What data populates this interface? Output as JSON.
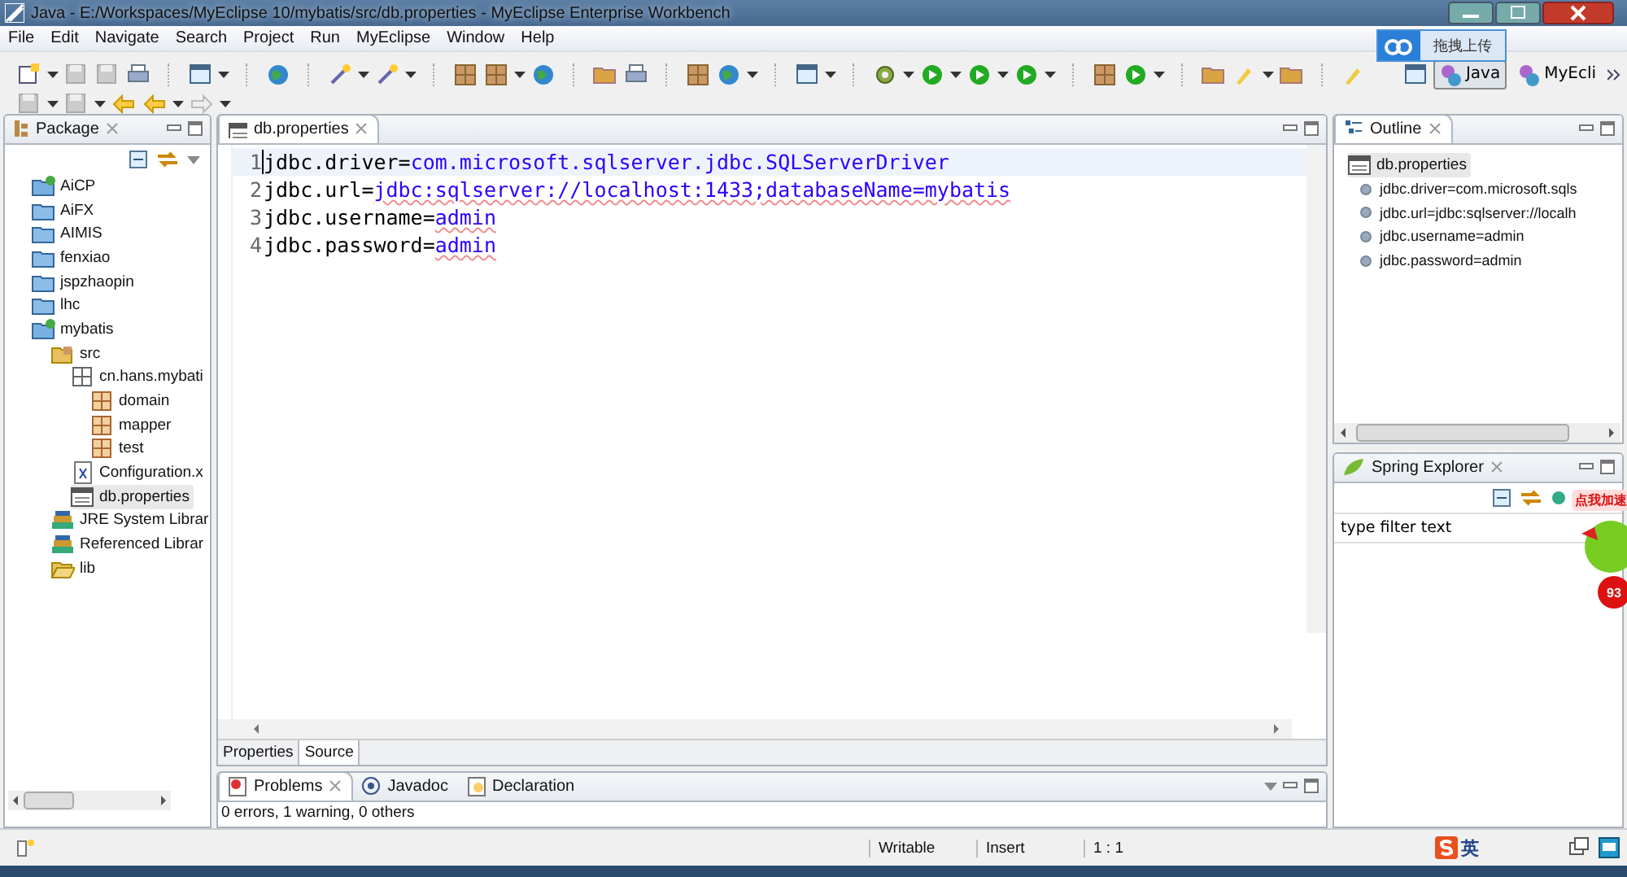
{
  "window": {
    "title": "Java - E:/Workspaces/MyEclipse 10/mybatis/src/db.properties - MyEclipse Enterprise Workbench"
  },
  "menu": [
    "File",
    "Edit",
    "Navigate",
    "Search",
    "Project",
    "Run",
    "MyEclipse",
    "Window",
    "Help"
  ],
  "upload_popup": {
    "label": "拖拽上传"
  },
  "perspectives": [
    {
      "label": "Java",
      "selected": true
    },
    {
      "label": "MyEcli",
      "selected": false
    }
  ],
  "package_view": {
    "title": "Package",
    "items": [
      {
        "label": "AiCP",
        "kind": "project",
        "selected": false
      },
      {
        "label": "AiFX",
        "kind": "folder",
        "selected": false
      },
      {
        "label": "AIMIS",
        "kind": "folder",
        "selected": false
      },
      {
        "label": "fenxiao",
        "kind": "folder",
        "selected": false
      },
      {
        "label": "jspzhaopin",
        "kind": "folder",
        "selected": false
      },
      {
        "label": "lhc",
        "kind": "folder",
        "selected": false
      },
      {
        "label": "mybatis",
        "kind": "project",
        "selected": false,
        "children": [
          {
            "label": "src",
            "kind": "source",
            "selected": false,
            "children": [
              {
                "label": "cn.hans.mybati",
                "kind": "package",
                "selected": false,
                "children": [
                  {
                    "label": "domain",
                    "kind": "subpackage",
                    "selected": false
                  },
                  {
                    "label": "mapper",
                    "kind": "subpackage",
                    "selected": false
                  },
                  {
                    "label": "test",
                    "kind": "subpackage",
                    "selected": false
                  }
                ]
              },
              {
                "label": "Configuration.x",
                "kind": "xml",
                "selected": false
              },
              {
                "label": "db.properties",
                "kind": "properties",
                "selected": true
              }
            ]
          },
          {
            "label": "JRE System Librar",
            "kind": "library",
            "selected": false
          },
          {
            "label": "Referenced Librar",
            "kind": "library",
            "selected": false
          },
          {
            "label": "lib",
            "kind": "folder-open",
            "selected": false
          }
        ]
      }
    ]
  },
  "editor": {
    "tabs": [
      {
        "label": "db.properties",
        "selected": true
      }
    ],
    "lines": [
      {
        "number": "1",
        "key": "jdbc.driver=",
        "value": "com.microsoft.sqlserver.jdbc.SQLServerDriver",
        "underlined": false,
        "current": true
      },
      {
        "number": "2",
        "key": "jdbc.url=",
        "value": "jdbc:sqlserver://localhost:1433;databaseName=mybatis",
        "underlined": true,
        "current": false
      },
      {
        "number": "3",
        "key": "jdbc.username=",
        "value": "admin",
        "underlined": true,
        "current": false
      },
      {
        "number": "4",
        "key": "jdbc.password=",
        "value": "admin",
        "underlined": true,
        "current": false
      }
    ],
    "bottom_tabs": [
      {
        "label": "Properties",
        "selected": false
      },
      {
        "label": "Source",
        "selected": true
      }
    ]
  },
  "outline": {
    "title": "Outline",
    "root": {
      "label": "db.properties",
      "selected": true,
      "children": [
        {
          "label": "jdbc.driver=com.microsoft.sqls"
        },
        {
          "label": "jdbc.url=jdbc:sqlserver://localh"
        },
        {
          "label": "jdbc.username=admin"
        },
        {
          "label": "jdbc.password=admin"
        }
      ]
    }
  },
  "spring_explorer": {
    "title": "Spring Explorer",
    "filter": {
      "value": "type filter text"
    }
  },
  "problems": {
    "tabs": [
      {
        "label": "Problems",
        "selected": true
      },
      {
        "label": "Javadoc",
        "selected": false
      },
      {
        "label": "Declaration",
        "selected": false
      }
    ],
    "summary": "0 errors, 1 warning, 0 others"
  },
  "status_bar": {
    "fields": [
      "Writable",
      "Insert",
      "1 : 1"
    ],
    "ime": "英"
  },
  "accelerator_widget": {
    "label": "点我加速",
    "badge": "93"
  }
}
